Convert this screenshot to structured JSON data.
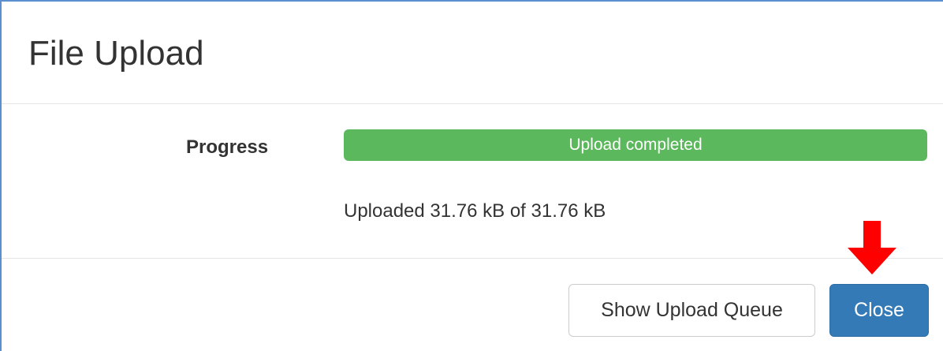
{
  "dialog": {
    "title": "File Upload"
  },
  "progress": {
    "label": "Progress",
    "bar_text": "Upload completed",
    "percent": 100,
    "bar_color": "#5cb85c",
    "uploaded_text": "Uploaded 31.76 kB of 31.76 kB"
  },
  "footer": {
    "queue_button_label": "Show Upload Queue",
    "close_button_label": "Close",
    "primary_color": "#337ab7"
  },
  "annotation": {
    "arrow_icon": "red-arrow-down-icon",
    "arrow_color": "#ff0000"
  }
}
